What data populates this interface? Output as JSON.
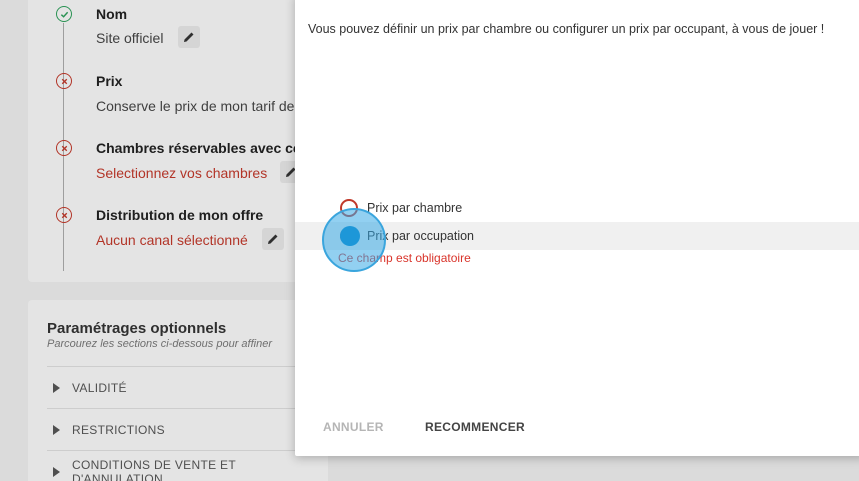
{
  "steps": [
    {
      "title": "Nom",
      "value": "Site officiel",
      "status": "ok"
    },
    {
      "title": "Prix",
      "value": "Conserve le prix de mon tarif de",
      "status": "error"
    },
    {
      "title": "Chambres réservables avec cet",
      "value": "Selectionnez vos chambres",
      "status": "error"
    },
    {
      "title": "Distribution de mon offre",
      "value": "Aucun canal sélectionné",
      "status": "error"
    }
  ],
  "options": {
    "title": "Paramétrages optionnels",
    "subtitle": "Parcourez les sections ci-dessous pour affiner",
    "sections": [
      "VALIDITÉ",
      "RESTRICTIONS",
      "CONDITIONS DE VENTE ET D'ANNULATION"
    ]
  },
  "dialog": {
    "text": "Vous pouvez définir un prix par chambre ou configurer un prix par occupant, à vous de jouer !",
    "radio_per_room": "Prix par chambre",
    "radio_per_occupancy": "Prix par occupation",
    "error": "Ce champ est obligatoire",
    "cancel_label": "ANNULER",
    "reset_label": "RECOMMENCER"
  },
  "colors": {
    "error": "#d9342b",
    "ok": "#2e9e5a",
    "click": "#1d97d8"
  }
}
